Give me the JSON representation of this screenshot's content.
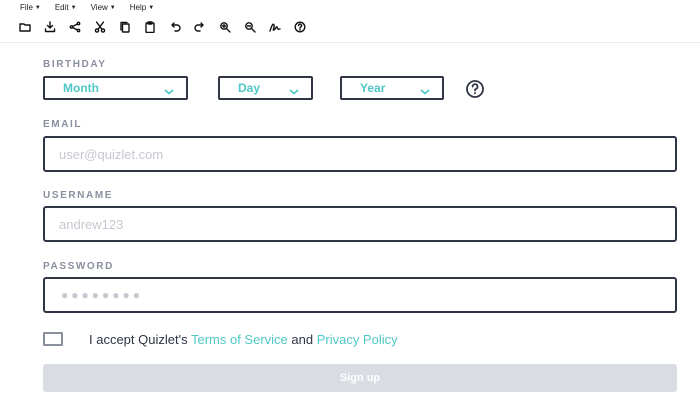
{
  "menubar": {
    "items": [
      {
        "label": "File"
      },
      {
        "label": "Edit"
      },
      {
        "label": "View"
      },
      {
        "label": "Help"
      }
    ]
  },
  "toolbar": {
    "icons": [
      "folder-icon",
      "download-icon",
      "share-icon",
      "cut-icon",
      "copy-icon",
      "paste-icon",
      "undo-icon",
      "redo-icon",
      "zoom-in-icon",
      "zoom-out-icon",
      "signature-icon",
      "help-icon"
    ]
  },
  "form": {
    "birthday": {
      "label": "BIRTHDAY",
      "month": "Month",
      "day": "Day",
      "year": "Year"
    },
    "email": {
      "label": "EMAIL",
      "placeholder": "user@quizlet.com",
      "value": ""
    },
    "username": {
      "label": "USERNAME",
      "placeholder": "andrew123",
      "value": ""
    },
    "password": {
      "label": "PASSWORD",
      "placeholder": "●●●●●●●●"
    },
    "terms": {
      "prefix": "I accept Quizlet's ",
      "tos_link": "Terms of Service",
      "middle": " and ",
      "privacy_link": "Privacy Policy"
    },
    "signup_label": "Sign up"
  },
  "colors": {
    "accent": "#4fc8c6",
    "border": "#303545",
    "label": "#8a8fa0",
    "button_disabled": "#d9dce3"
  }
}
